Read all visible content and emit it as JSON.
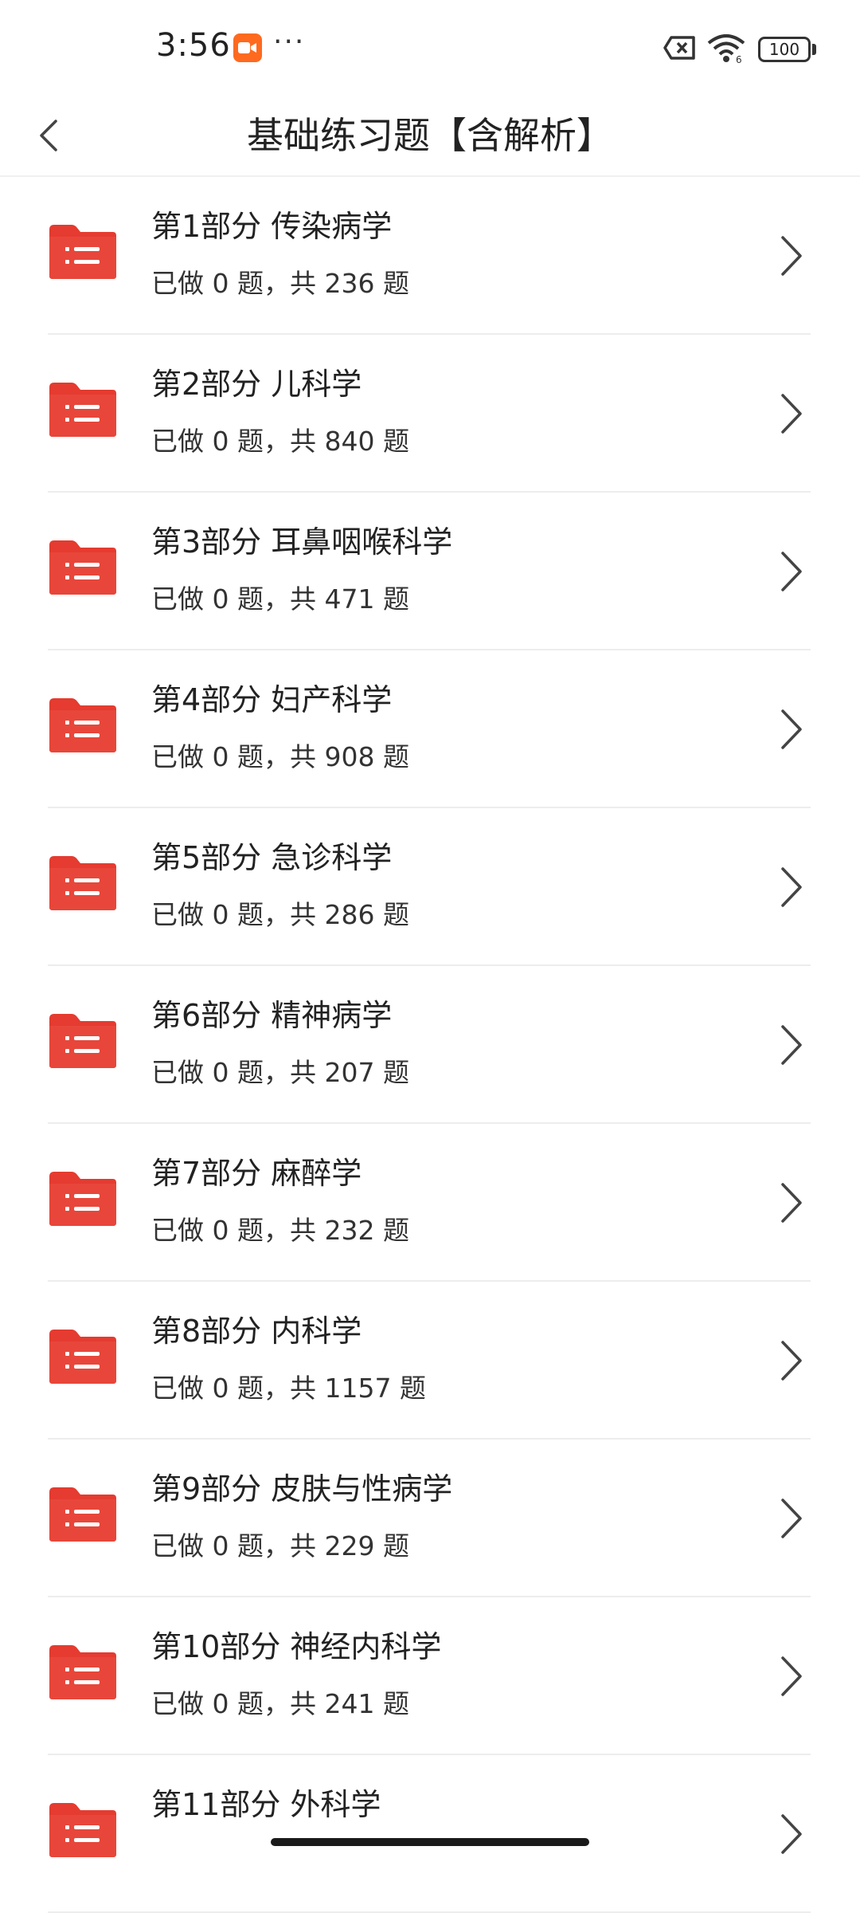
{
  "status_bar": {
    "time": "3:56",
    "more": "···",
    "battery": "100"
  },
  "header": {
    "title": "基础练习题【含解析】"
  },
  "colors": {
    "folder_red": "#e53b30",
    "rec_orange": "#ff6a1f"
  },
  "items": [
    {
      "title": "第1部分 传染病学",
      "subtitle": "已做 0 题，共 236 题"
    },
    {
      "title": "第2部分 儿科学",
      "subtitle": "已做 0 题，共 840 题"
    },
    {
      "title": "第3部分 耳鼻咽喉科学",
      "subtitle": "已做 0 题，共 471 题"
    },
    {
      "title": "第4部分 妇产科学",
      "subtitle": "已做 0 题，共 908 题"
    },
    {
      "title": "第5部分 急诊科学",
      "subtitle": "已做 0 题，共 286 题"
    },
    {
      "title": "第6部分 精神病学",
      "subtitle": "已做 0 题，共 207 题"
    },
    {
      "title": "第7部分 麻醉学",
      "subtitle": "已做 0 题，共 232 题"
    },
    {
      "title": "第8部分 内科学",
      "subtitle": "已做 0 题，共 1157 题"
    },
    {
      "title": "第9部分 皮肤与性病学",
      "subtitle": "已做 0 题，共 229 题"
    },
    {
      "title": "第10部分 神经内科学",
      "subtitle": "已做 0 题，共 241 题"
    },
    {
      "title": "第11部分 外科学",
      "subtitle": ""
    }
  ],
  "icons": {
    "back": "chevron-left-icon",
    "item": "folder-list-icon",
    "row_arrow": "chevron-right-icon"
  }
}
